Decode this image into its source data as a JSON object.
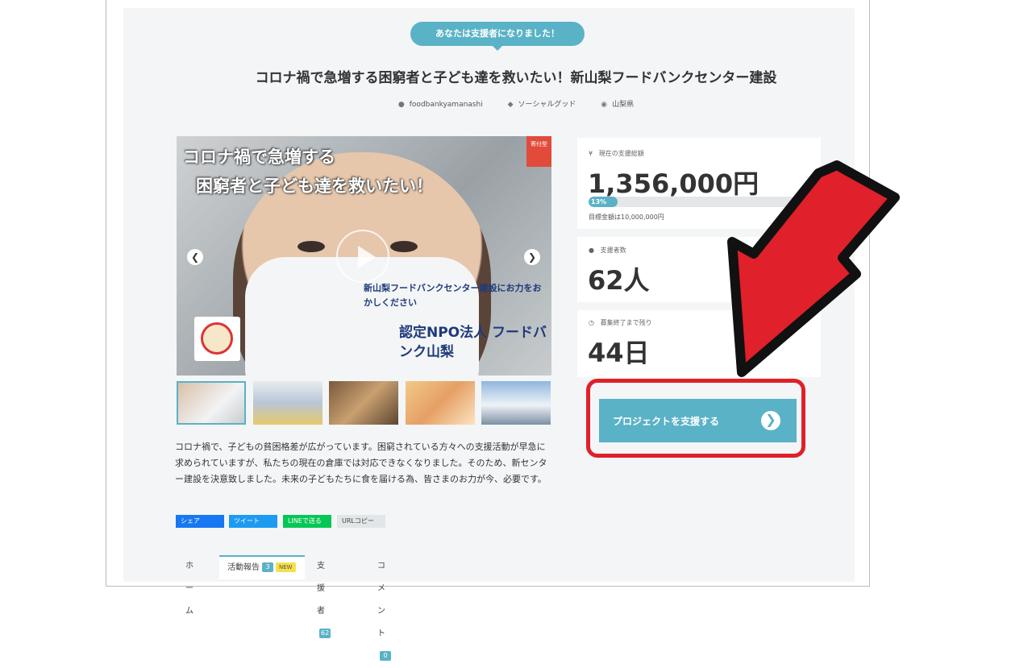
{
  "badge": "あなたは支援者になりました！",
  "project": {
    "title": "コロナ禍で急増する困窮者と子ども達を救いたい！新山梨フードバンクセンター建設",
    "author": "foodbankyamanashi",
    "category": "ソーシャルグッド",
    "location": "山梨県"
  },
  "hero": {
    "line1": "コロナ禍で急増する",
    "line2": "困窮者と子ども達を救いたい！",
    "sub": "新山梨フードバンクセンター建設にお力をおかしください",
    "org": "認定NPO法人 フードバンク山梨",
    "tag": "寄付型"
  },
  "description": "コロナ禍で、子どもの貧困格差が広がっています。困窮されている方々への支援活動が早急に求められていますが、私たちの現在の倉庫では対応できなくなりました。そのため、新センター建設を決意致しました。未来の子どもたちに食を届ける為、皆さまのお力が今、必要です。",
  "share": {
    "facebook": "シェア",
    "twitter": "ツイート",
    "line": "LINEで送る",
    "url": "URLコピー"
  },
  "tabs": [
    {
      "label": "ホーム"
    },
    {
      "label": "活動報告",
      "count": "3",
      "badge": "NEW"
    },
    {
      "label": "支援者",
      "count": "62"
    },
    {
      "label": "コメント",
      "count": "0"
    }
  ],
  "stats": {
    "amount_label": "現在の支援総額",
    "amount": "1,356,000円",
    "progress_label": "13%",
    "progress_fraction": 0.13,
    "goal": "目標金額は10,000,000円",
    "supporters_label": "支援者数",
    "supporters": "62人",
    "remaining_label": "募集終了まで残り",
    "remaining": "44日"
  },
  "support_button": "プロジェクトを支援する",
  "icons": {
    "user": "user-icon",
    "tag": "tag-icon",
    "pin": "map-pin-icon",
    "yen": "yen-icon",
    "clock": "clock-icon"
  },
  "colors": {
    "accent": "#5ab2c7",
    "highlight_red": "#e0202a"
  }
}
